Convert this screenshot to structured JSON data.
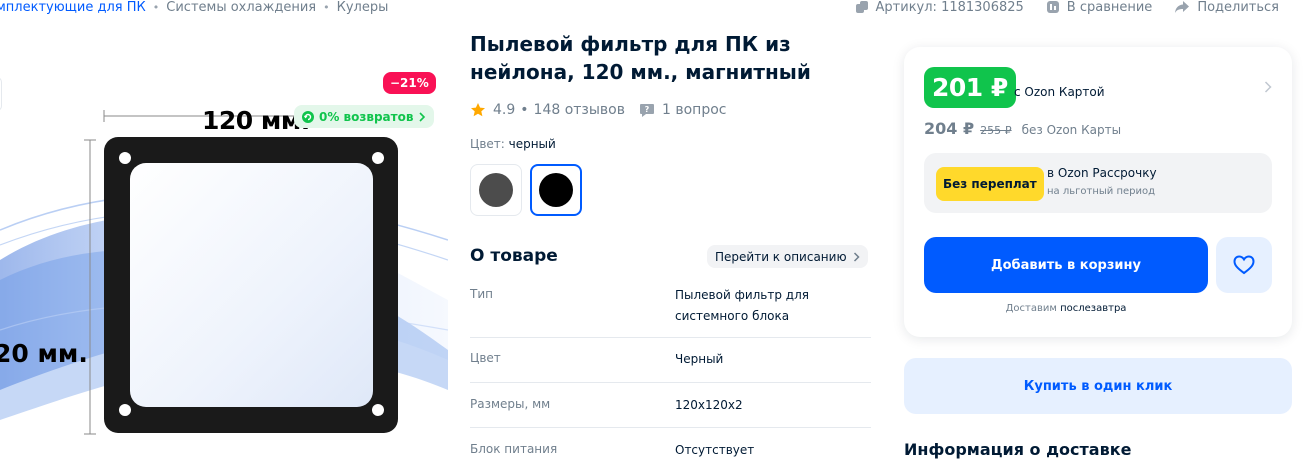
{
  "breadcrumb": {
    "items": [
      "мплектующие для ПК",
      "Системы охлаждения",
      "Кулеры"
    ],
    "separator": "•"
  },
  "top_actions": {
    "article": "Артикул: 1181306825",
    "compare": "В сравнение",
    "share": "Поделиться"
  },
  "gallery": {
    "discount": "−21%",
    "returns": "0% возвратов",
    "dimension_top": "120 мм.",
    "dimension_left": "20 мм."
  },
  "product": {
    "title": "Пылевой фильтр для ПК из нейлона, 120 мм., магнитный",
    "rating": "4.9",
    "reviews": "148 отзывов",
    "questions": "1 вопрос",
    "color_label": "Цвет: ",
    "color_value": "черный"
  },
  "about": {
    "title": "О товаре",
    "goto_description": "Перейти к описанию",
    "specs": [
      {
        "name": "Тип",
        "value": "Пылевой фильтр для системного блока"
      },
      {
        "name": "Цвет",
        "value": "Черный"
      },
      {
        "name": "Размеры, мм",
        "value": "120x120x2"
      },
      {
        "name": "Блок питания",
        "value": "Отсутствует"
      }
    ]
  },
  "price": {
    "ozon_card_price": "201 ₽",
    "ozon_card_caption": "с Ozon Картой",
    "regular_price": "204 ₽",
    "old_price": "255 ₽",
    "regular_caption": "без Ozon Карты",
    "installment_badge": "Без переплат",
    "installment_title": "в Ozon Рассрочку",
    "installment_sub": "на льготный период",
    "add_to_cart": "Добавить в корзину",
    "delivery_note_prefix": "Доставим ",
    "delivery_note_day": "послезавтра",
    "buy_one_click": "Купить в один клик",
    "delivery_info_title": "Информация о доставке"
  },
  "colors": {
    "accent": "#005bff",
    "green": "#10c44c",
    "discount": "#f91155",
    "installment_badge": "#ffd92b",
    "text_primary": "#001a34",
    "text_secondary": "#707f8d"
  },
  "icons": [
    "share-icon",
    "compare-icon",
    "returns-icon",
    "star-icon",
    "question-icon",
    "chevron-right-icon",
    "heart-icon"
  ]
}
